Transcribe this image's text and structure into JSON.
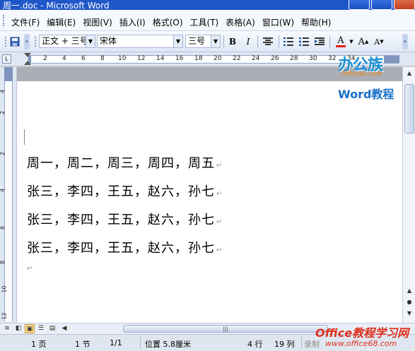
{
  "window": {
    "title": "周一.doc - Microsoft Word"
  },
  "menu": [
    "文件(F)",
    "编辑(E)",
    "视图(V)",
    "插入(I)",
    "格式(O)",
    "工具(T)",
    "表格(A)",
    "窗口(W)",
    "帮助(H)"
  ],
  "toolbar": {
    "style_value": "正文 + 三号",
    "font_value": "宋体",
    "size_value": "三号",
    "bold": "B",
    "italic": "I",
    "font_color": "A",
    "grow_font": "A",
    "shrink_font": "A"
  },
  "ruler": {
    "h_ticks": [
      "2",
      "4",
      "6",
      "8",
      "10",
      "12",
      "14",
      "16",
      "18",
      "20",
      "22",
      "24",
      "26",
      "28",
      "30",
      "32",
      "34"
    ],
    "v_ticks": [
      "4",
      "2",
      "2",
      "4",
      "6",
      "8",
      "10",
      "12"
    ]
  },
  "document": {
    "lines": [
      "周一，周二，周三，周四，周五",
      "张三，李四，王五，赵六，孙七",
      "张三，李四，王五，赵六，孙七",
      "张三，李四，王五，赵六，孙七"
    ],
    "paragraph_mark": "↵"
  },
  "status": {
    "page": "1 页",
    "section": "1 节",
    "page_of": "1/1",
    "position": "位置 5.8厘米",
    "line": "4 行",
    "column": "19 列",
    "record": "录制"
  },
  "watermarks": {
    "logo_main": "办公族",
    "logo_url": "Officezu.com",
    "logo_sub": "Word教程",
    "bottom_main": "Office教程学习网",
    "bottom_url": "www.office68.com"
  },
  "colors": {
    "titlebar": "#1f56c8",
    "font_color_underline": "#e0201a"
  }
}
